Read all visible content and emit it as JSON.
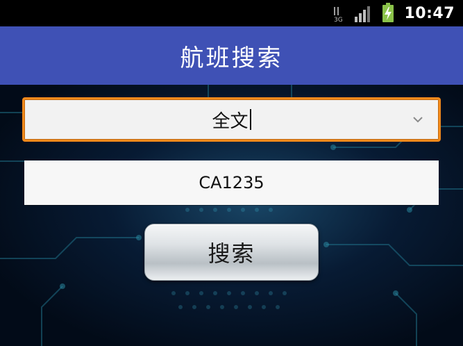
{
  "status_bar": {
    "time": "10:47",
    "network_label": "3G",
    "icons": [
      "network-3g-icon",
      "signal-icon",
      "battery-charging-icon"
    ]
  },
  "app_bar": {
    "title": "航班搜索"
  },
  "search_type": {
    "selected": "全文",
    "icon": "chevron-down-icon"
  },
  "flight_input": {
    "value": "CA1235"
  },
  "search_button": {
    "label": "搜索"
  },
  "colors": {
    "app_bar": "#3f51b5",
    "focus_border": "#f0891b",
    "status_bar": "#000000"
  }
}
